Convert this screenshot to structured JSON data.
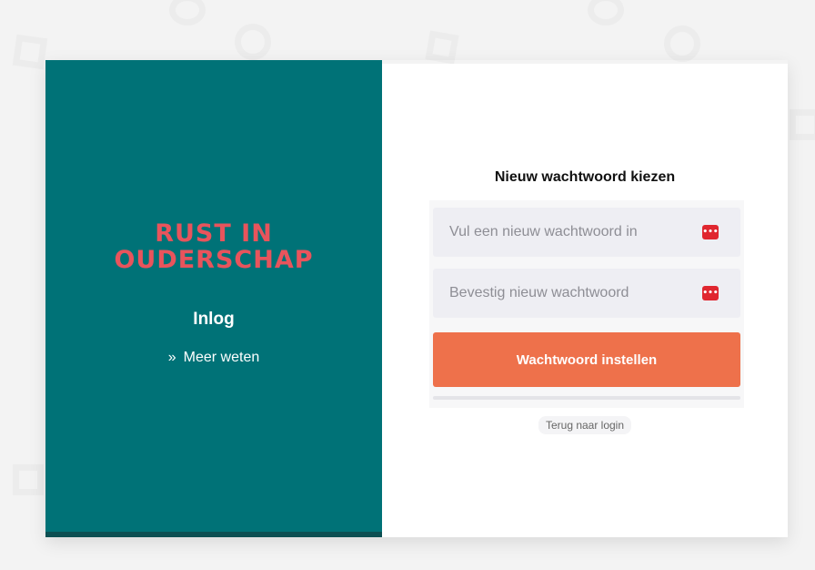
{
  "brand": {
    "line1": "RUST IN",
    "line2": "OUDERSCHAP",
    "color": "#e8545c"
  },
  "left_panel": {
    "background": "#007277",
    "login_label": "Inlog",
    "more_link": "Meer weten",
    "more_icon": "double-chevron-right-icon"
  },
  "form": {
    "title": "Nieuw wachtwoord kiezen",
    "new_password": {
      "placeholder": "Vul een nieuw wachtwoord in",
      "value": "",
      "icon": "password-manager-key-icon"
    },
    "confirm_password": {
      "placeholder": "Bevestig nieuw wachtwoord",
      "value": "",
      "icon": "password-manager-key-icon"
    },
    "submit_label": "Wachtwoord instellen",
    "submit_color": "#ee714b",
    "back_link": "Terug naar login"
  }
}
